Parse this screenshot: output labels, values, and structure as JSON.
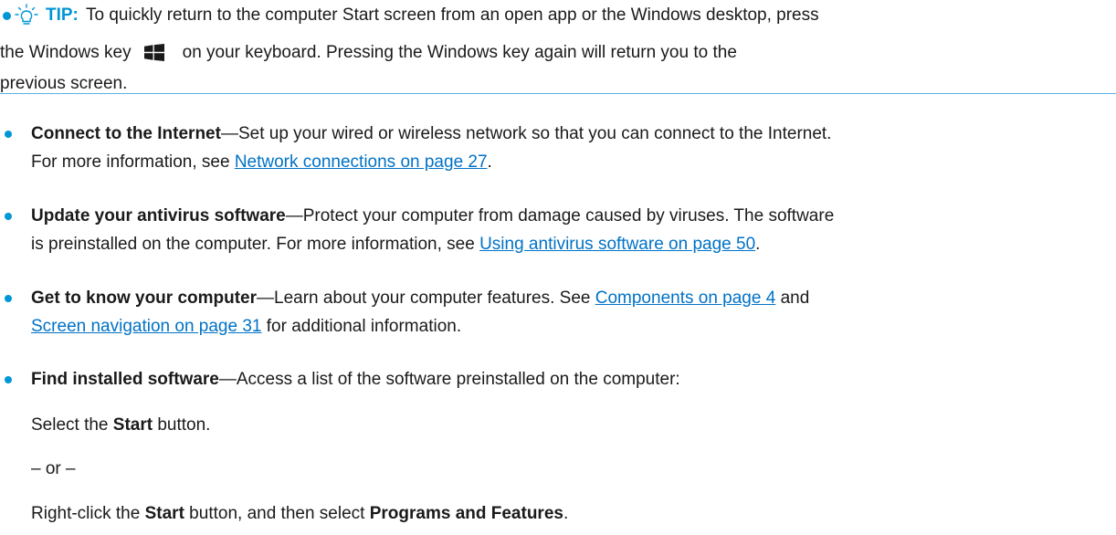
{
  "tip": {
    "label": "TIP:",
    "line1": "To quickly return to the computer Start screen from an open app or the Windows desktop, press",
    "line2_before": "the Windows key",
    "line2_after": "on your keyboard. Pressing the Windows key again will return you to the",
    "line3": "previous screen.",
    "icon": "lightbulb-icon"
  },
  "bullets": [
    {
      "title": "Connect to the Internet",
      "line1_text": "—Set up your wired or wireless network so that you can connect to the Internet.",
      "line2_prefix": "For more information, see ",
      "link1": "Network connections on page 27",
      "line2_suffix": "."
    },
    {
      "title": "Update your antivirus software",
      "line1_text": "—Protect your computer from damage caused by viruses. The software",
      "line2_prefix": "is preinstalled on the computer. For more information, see ",
      "link1": "Using antivirus software on page 50",
      "line2_suffix": "."
    },
    {
      "title": "Get to know your computer",
      "line1_text": "—Learn about your computer features. See ",
      "link1": "Components on page 4",
      "line1_suffix": " and",
      "link2": "Screen navigation on page 31",
      "line2_suffix": " for additional information."
    },
    {
      "title": "Find installed software",
      "line1_text": "—Access a list of the software preinstalled on the computer:"
    }
  ],
  "steps": {
    "select_prefix": "Select the ",
    "start": "Start",
    "select_suffix": " button.",
    "or": "– or –",
    "right_prefix": "Right-click the ",
    "right_middle": " button, and then select ",
    "programs": "Programs and Features",
    "right_suffix": "."
  },
  "colors": {
    "accent": "#0096d6",
    "link": "#0072c6",
    "rule": "#5cb2e0"
  }
}
